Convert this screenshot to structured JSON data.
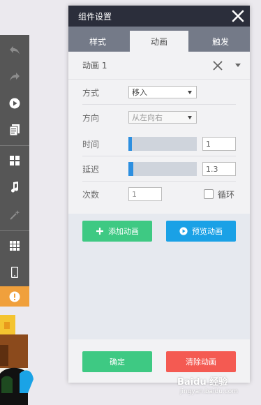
{
  "panel": {
    "title": "组件设置",
    "close_icon": "close-icon"
  },
  "tabs": [
    {
      "label": "样式",
      "active": false
    },
    {
      "label": "动画",
      "active": true
    },
    {
      "label": "触发",
      "active": false
    }
  ],
  "animation": {
    "name": "动画 1",
    "mode_label": "方式",
    "mode_value": "移入",
    "direction_label": "方向",
    "direction_value": "从左向右",
    "duration_label": "时间",
    "duration_value": "1",
    "delay_label": "延迟",
    "delay_value": "1.3",
    "count_label": "次数",
    "count_value": "1",
    "loop_label": "循环",
    "loop_checked": false
  },
  "actions": {
    "add_label": "添加动画",
    "preview_label": "预览动画"
  },
  "footer": {
    "confirm_label": "确定",
    "clear_label": "清除动画"
  },
  "toolbar": {
    "icons": [
      "undo-icon",
      "redo-icon",
      "play-icon",
      "document-icon",
      "grid-icon",
      "music-icon",
      "magic-icon",
      "table-icon",
      "phone-icon",
      "alert-icon"
    ]
  },
  "watermark": {
    "text": "Baidu 经验",
    "sub": "jingyan.baidu.com"
  },
  "colors": {
    "header_bg": "#2b2e3b",
    "tab_bar": "#747a88",
    "green": "#3ec983",
    "blue": "#1aa1e6",
    "red": "#f45a52",
    "slider_fill": "#2d8fe0"
  }
}
